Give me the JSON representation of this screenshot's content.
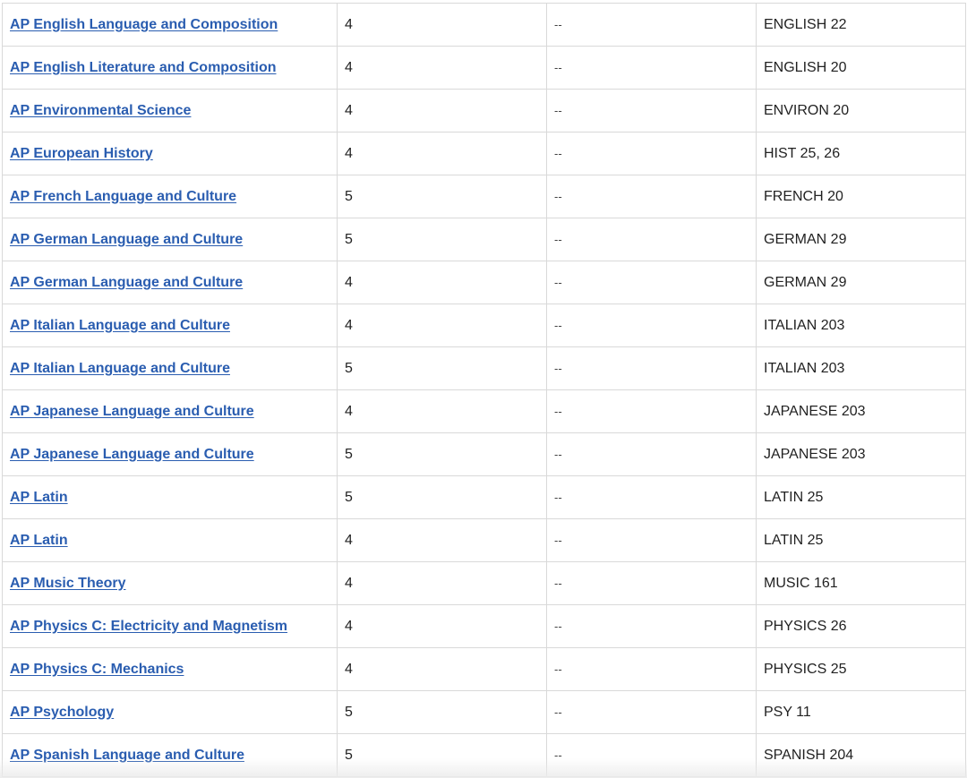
{
  "table": {
    "rows": [
      {
        "exam": "AP English Language and Composition",
        "score": "4",
        "units": "--",
        "course": "ENGLISH 22"
      },
      {
        "exam": "AP English Literature and Composition",
        "score": "4",
        "units": "--",
        "course": "ENGLISH 20"
      },
      {
        "exam": "AP Environmental Science",
        "score": "4",
        "units": "--",
        "course": "ENVIRON 20"
      },
      {
        "exam": "AP European History",
        "score": "4",
        "units": "--",
        "course": "HIST 25, 26"
      },
      {
        "exam": "AP French Language and Culture",
        "score": "5",
        "units": "--",
        "course": "FRENCH 20"
      },
      {
        "exam": "AP German Language and Culture",
        "score": "5",
        "units": "--",
        "course": "GERMAN 29"
      },
      {
        "exam": "AP German Language and Culture",
        "score": "4",
        "units": "--",
        "course": "GERMAN 29"
      },
      {
        "exam": "AP Italian Language and Culture",
        "score": "4",
        "units": "--",
        "course": "ITALIAN 203"
      },
      {
        "exam": "AP Italian Language and Culture",
        "score": "5",
        "units": "--",
        "course": "ITALIAN 203"
      },
      {
        "exam": "AP Japanese Language and Culture",
        "score": "4",
        "units": "--",
        "course": "JAPANESE 203"
      },
      {
        "exam": "AP Japanese Language and Culture",
        "score": "5",
        "units": "--",
        "course": "JAPANESE 203"
      },
      {
        "exam": "AP Latin",
        "score": "5",
        "units": "--",
        "course": "LATIN 25"
      },
      {
        "exam": "AP Latin",
        "score": "4",
        "units": "--",
        "course": "LATIN 25"
      },
      {
        "exam": "AP Music Theory",
        "score": "4",
        "units": "--",
        "course": "MUSIC 161"
      },
      {
        "exam": "AP Physics C: Electricity and Magnetism",
        "score": "4",
        "units": "--",
        "course": "PHYSICS 26"
      },
      {
        "exam": "AP Physics C: Mechanics",
        "score": "4",
        "units": "--",
        "course": "PHYSICS 25"
      },
      {
        "exam": "AP Psychology",
        "score": "5",
        "units": "--",
        "course": "PSY 11"
      },
      {
        "exam": "AP Spanish Language and Culture",
        "score": "5",
        "units": "--",
        "course": "SPANISH 204"
      }
    ]
  },
  "colors": {
    "link": "#2a5db0",
    "text": "#222222",
    "border": "#d9d9d9"
  }
}
